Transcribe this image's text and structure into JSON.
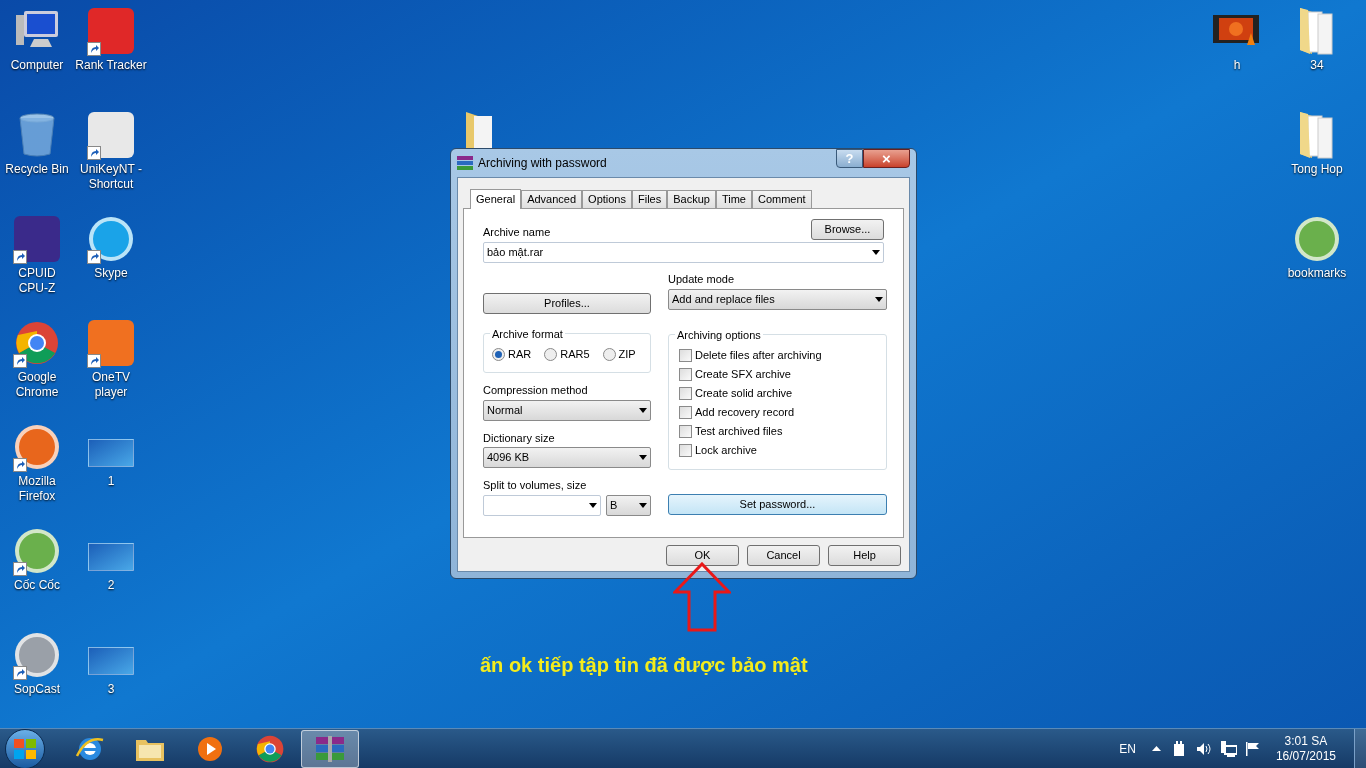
{
  "desktop": {
    "left_icons": [
      {
        "label": "Computer",
        "kind": "computer",
        "shortcut": false
      },
      {
        "label": "Rank Tracker",
        "kind": "app",
        "color": "#e02828",
        "shortcut": true
      },
      {
        "label": "Recycle Bin",
        "kind": "bin",
        "shortcut": false
      },
      {
        "label": "UniKeyNT - Shortcut",
        "kind": "app",
        "color": "#e8e8e8",
        "shortcut": true
      },
      {
        "label": "CPUID CPU-Z",
        "kind": "app",
        "color": "#3a2a8a",
        "shortcut": true
      },
      {
        "label": "Skype",
        "kind": "round",
        "color": "#1aa3e8",
        "shortcut": true
      },
      {
        "label": "Google Chrome",
        "kind": "chrome",
        "shortcut": true
      },
      {
        "label": "OneTV player",
        "kind": "app",
        "color": "#f07020",
        "shortcut": true
      },
      {
        "label": "Mozilla Firefox",
        "kind": "round",
        "color": "#e8661c",
        "shortcut": true
      },
      {
        "label": "1",
        "kind": "screenshot",
        "shortcut": false
      },
      {
        "label": "Cốc Cốc",
        "kind": "round",
        "color": "#6ab04c",
        "shortcut": true
      },
      {
        "label": "2",
        "kind": "screenshot",
        "shortcut": false
      },
      {
        "label": "SopCast",
        "kind": "round",
        "color": "#9aa0a8",
        "shortcut": true
      },
      {
        "label": "3",
        "kind": "screenshot",
        "shortcut": false
      }
    ],
    "right_icons": [
      {
        "label": "h",
        "kind": "video",
        "shortcut": false
      },
      {
        "label": "34",
        "kind": "folder",
        "shortcut": false
      },
      {
        "label": "Tong Hop",
        "kind": "folder",
        "shortcut": false
      },
      {
        "label": "bookmarks",
        "kind": "round",
        "color": "#6ab04c",
        "shortcut": false
      }
    ]
  },
  "dialog": {
    "title": "Archiving with password",
    "help": "?",
    "close": "×",
    "tabs": [
      {
        "label": "General",
        "selected": true
      },
      {
        "label": "Advanced",
        "selected": false
      },
      {
        "label": "Options",
        "selected": false
      },
      {
        "label": "Files",
        "selected": false
      },
      {
        "label": "Backup",
        "selected": false
      },
      {
        "label": "Time",
        "selected": false
      },
      {
        "label": "Comment",
        "selected": false
      }
    ],
    "archive_name": {
      "label": "Archive name",
      "value": "bảo mật.rar",
      "browse": "Browse..."
    },
    "profiles": "Profiles...",
    "update_mode": {
      "label": "Update mode",
      "value": "Add and replace files"
    },
    "archive_format": {
      "label": "Archive format",
      "options": [
        {
          "label": "RAR",
          "selected": true
        },
        {
          "label": "RAR5",
          "selected": false
        },
        {
          "label": "ZIP",
          "selected": false
        }
      ]
    },
    "compression_method": {
      "label": "Compression method",
      "value": "Normal"
    },
    "dictionary_size": {
      "label": "Dictionary size",
      "value": "4096 KB"
    },
    "split": {
      "label": "Split to volumes, size",
      "unit": "B"
    },
    "archiving_options": {
      "label": "Archiving options",
      "items": [
        {
          "label": "Delete files after archiving",
          "checked": false
        },
        {
          "label": "Create SFX archive",
          "checked": false
        },
        {
          "label": "Create solid archive",
          "checked": false
        },
        {
          "label": "Add recovery record",
          "checked": false
        },
        {
          "label": "Test archived files",
          "checked": false
        },
        {
          "label": "Lock archive",
          "checked": false
        }
      ]
    },
    "set_password": "Set password...",
    "buttons": [
      "OK",
      "Cancel",
      "Help"
    ]
  },
  "caption": "ấn ok tiếp tập tin đã được bảo mật",
  "taskbar": {
    "pinned": [
      {
        "kind": "ie",
        "active": false
      },
      {
        "kind": "explorer",
        "active": false
      },
      {
        "kind": "media",
        "active": false
      },
      {
        "kind": "chrome",
        "active": false
      },
      {
        "kind": "winrar",
        "active": true
      }
    ],
    "language": "EN",
    "time": "3:01 SA",
    "date": "16/07/2015"
  }
}
